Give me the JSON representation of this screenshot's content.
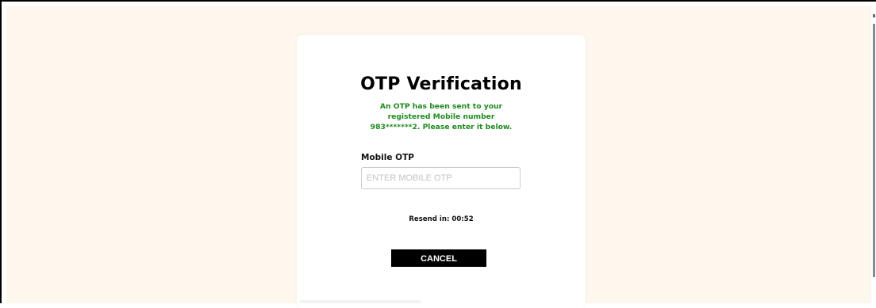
{
  "otp": {
    "title": "OTP Verification",
    "message": "An OTP has been sent to your registered Mobile number 983*******2. Please enter it below.",
    "field_label": "Mobile OTP",
    "input_placeholder": "ENTER MOBILE OTP",
    "input_value": "",
    "resend_text": "Resend in: 00:52",
    "cancel_label": "CANCEL"
  },
  "colors": {
    "page_background": "#fef7ee",
    "card_background": "#ffffff",
    "message_green": "#1e8a1e",
    "button_black": "#000000"
  }
}
